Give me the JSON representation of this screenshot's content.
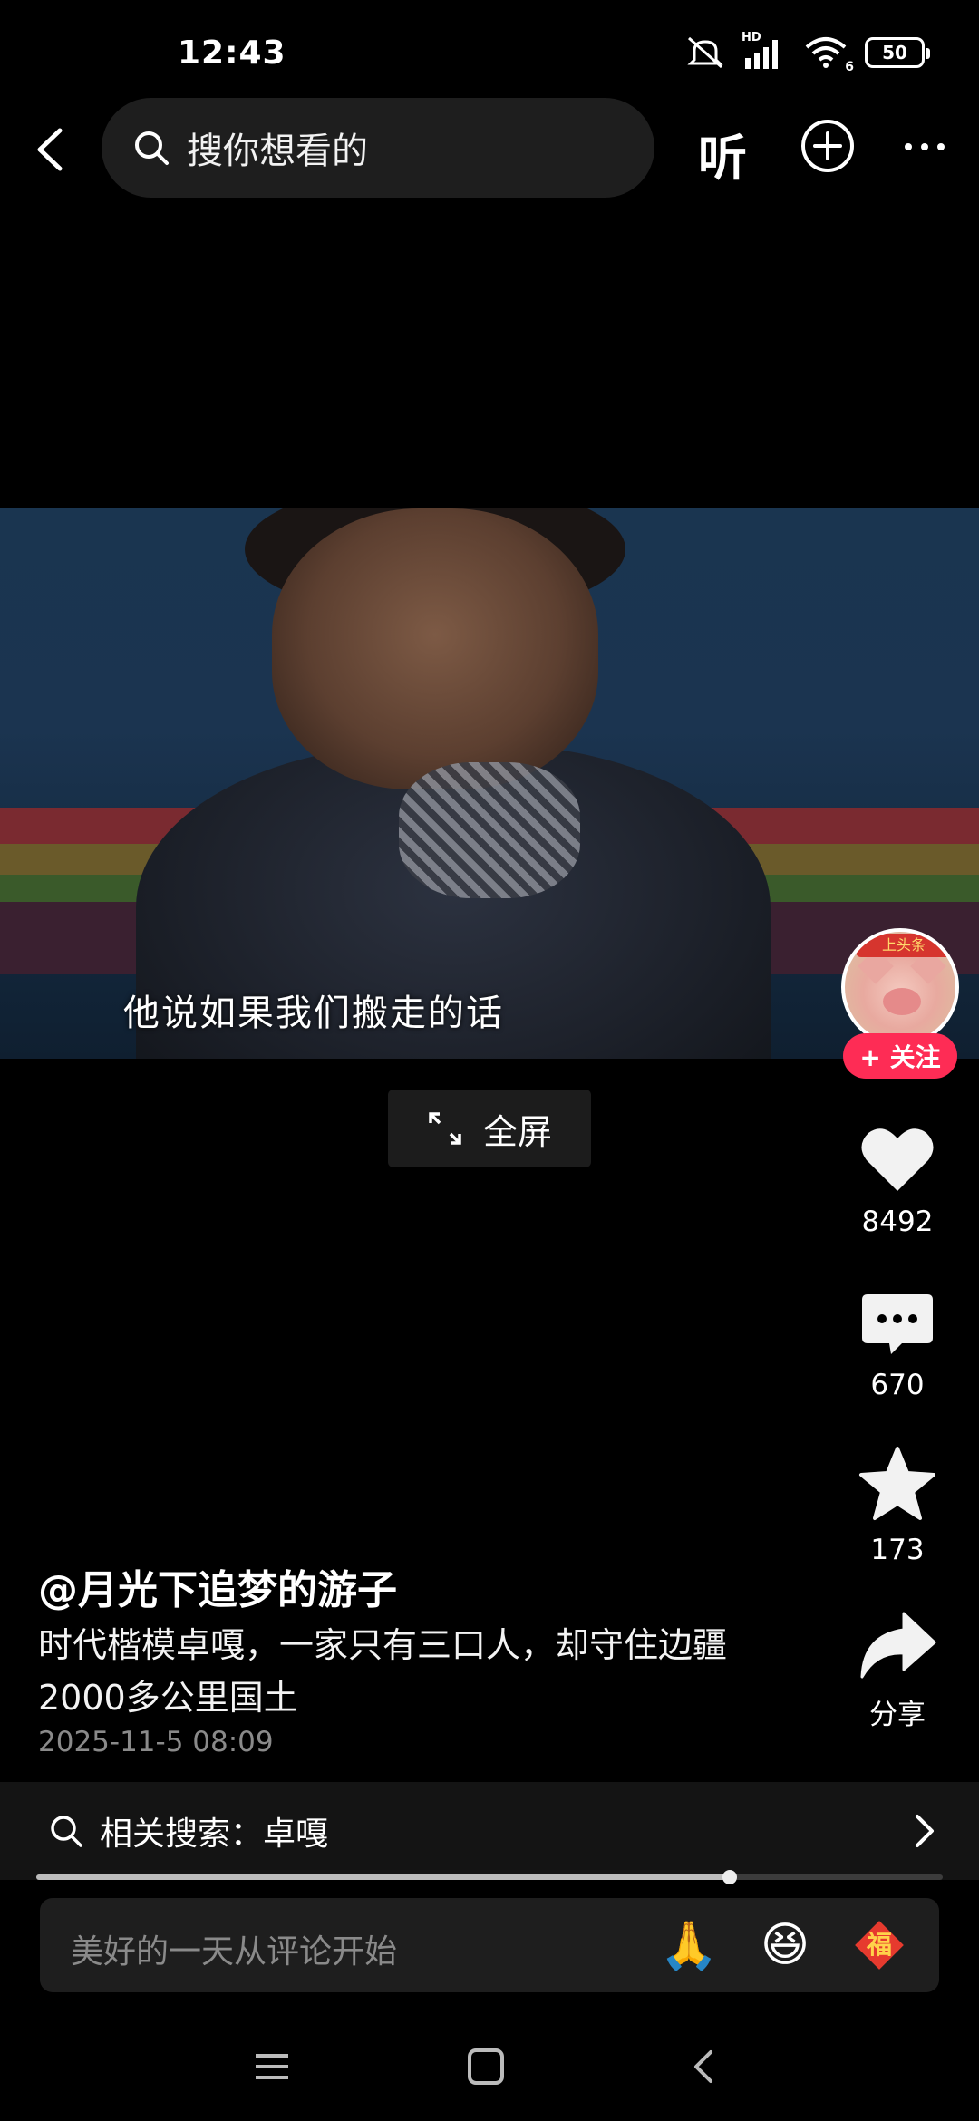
{
  "status_bar": {
    "time": "12:43",
    "battery": "50",
    "network_label": "HD",
    "wifi_label": "6"
  },
  "search": {
    "placeholder": "搜你想看的"
  },
  "top_actions": {
    "listen_label": "听"
  },
  "video": {
    "subtitle": "他说如果我们搬走的话"
  },
  "fullscreen": {
    "label": "全屏"
  },
  "creator": {
    "banner": "上头条",
    "follow_label": "+ 关注"
  },
  "actions": {
    "like_count": "8492",
    "comment_count": "670",
    "favorite_count": "173",
    "share_label": "分享"
  },
  "post": {
    "author": "@月光下追梦的游子",
    "description": "时代楷模卓嘎，一家只有三口人，却守住边疆2000多公里国土",
    "date": "2025-11-5 08:09"
  },
  "related_search": {
    "label": "相关搜索：卓嘎"
  },
  "playback": {
    "progress": 0.765
  },
  "comment_bar": {
    "placeholder": "美好的一天从评论开始",
    "emojis": [
      "🙏",
      "😆",
      "福"
    ]
  },
  "colors": {
    "accent": "#fe2c55",
    "background": "#000000"
  }
}
